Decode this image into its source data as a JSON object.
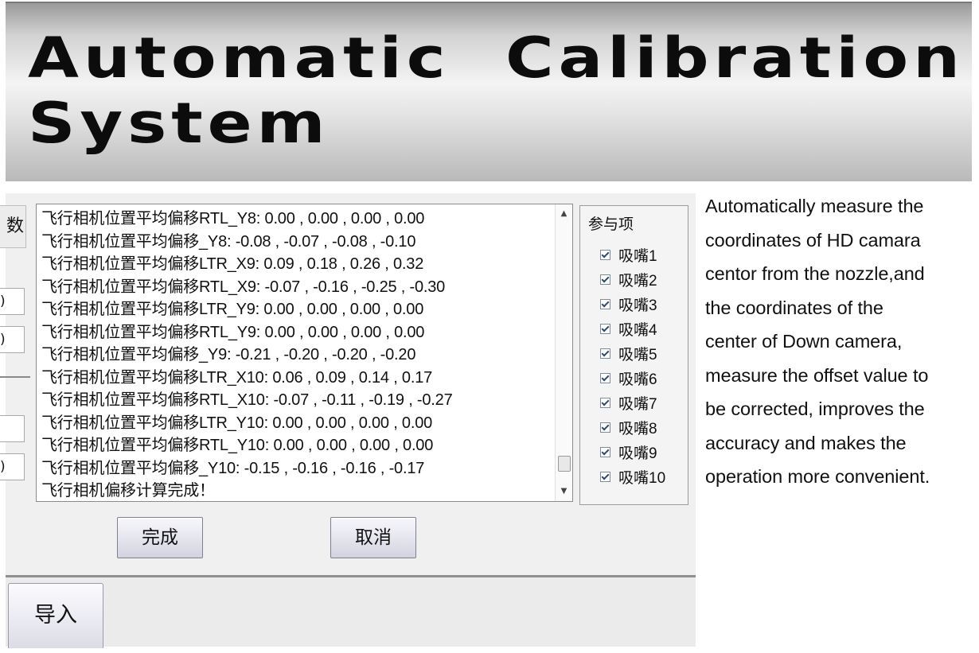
{
  "banner": {
    "title_line1": "Automatic  Calibration",
    "title_line2": "System"
  },
  "left_strip": {
    "label": "数",
    "field_values": [
      ")",
      ")",
      "",
      ")"
    ]
  },
  "log": {
    "lines": [
      "飞行相机位置平均偏移RTL_Y8: 0.00 , 0.00 , 0.00 , 0.00",
      "飞行相机位置平均偏移_Y8: -0.08 , -0.07 , -0.08 , -0.10",
      "飞行相机位置平均偏移LTR_X9: 0.09 , 0.18 , 0.26 , 0.32",
      "飞行相机位置平均偏移RTL_X9: -0.07 , -0.16 , -0.25 , -0.30",
      "飞行相机位置平均偏移LTR_Y9: 0.00 , 0.00 , 0.00 , 0.00",
      "飞行相机位置平均偏移RTL_Y9: 0.00 , 0.00 , 0.00 , 0.00",
      "飞行相机位置平均偏移_Y9: -0.21 , -0.20 , -0.20 , -0.20",
      "飞行相机位置平均偏移LTR_X10: 0.06 , 0.09 , 0.14 , 0.17",
      "飞行相机位置平均偏移RTL_X10: -0.07 , -0.11 , -0.19 , -0.27",
      "飞行相机位置平均偏移LTR_Y10: 0.00 , 0.00 , 0.00 , 0.00",
      "飞行相机位置平均偏移RTL_Y10: 0.00 , 0.00 , 0.00 , 0.00",
      "飞行相机位置平均偏移_Y10: -0.15 , -0.16 , -0.16 , -0.17",
      "飞行相机偏移计算完成！"
    ],
    "scroll_position": 0.95
  },
  "participants": {
    "title": "参与项",
    "items": [
      {
        "label": "吸嘴1",
        "checked": true
      },
      {
        "label": "吸嘴2",
        "checked": true
      },
      {
        "label": "吸嘴3",
        "checked": true
      },
      {
        "label": "吸嘴4",
        "checked": true
      },
      {
        "label": "吸嘴5",
        "checked": true
      },
      {
        "label": "吸嘴6",
        "checked": true
      },
      {
        "label": "吸嘴7",
        "checked": true
      },
      {
        "label": "吸嘴8",
        "checked": true
      },
      {
        "label": "吸嘴9",
        "checked": true
      },
      {
        "label": "吸嘴10",
        "checked": true
      }
    ]
  },
  "buttons": {
    "done": "完成",
    "cancel": "取消",
    "import": "导入"
  },
  "description": {
    "lines": [
      "Automatically measure the",
      "coordinates of HD camara",
      "centor from the nozzle,and",
      "the coordinates of the",
      "center of Down camera,",
      "measure the offset value to",
      "be corrected, improves the",
      "accuracy and makes the",
      "operation more convenient."
    ]
  },
  "icons": {
    "scroll_up": "scroll-up-arrow-icon",
    "scroll_down": "scroll-down-arrow-icon",
    "checkbox": "checkmark-icon"
  }
}
